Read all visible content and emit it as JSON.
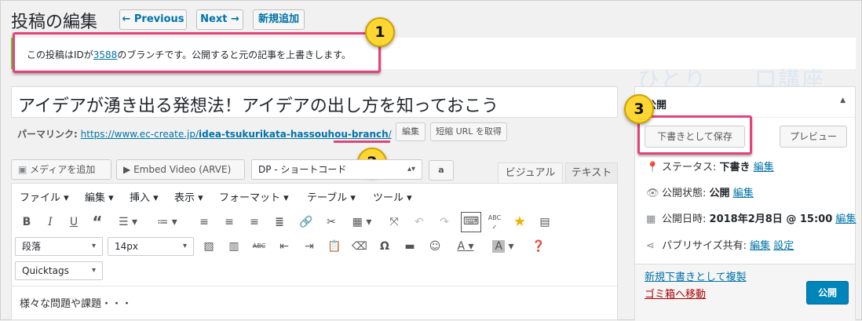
{
  "header": {
    "title": "投稿の編集",
    "prev_label": "← Previous",
    "next_label": "Next →",
    "new_label": "新規追加"
  },
  "notice": {
    "prefix": "この投稿はIDが",
    "post_id": "3588",
    "suffix": "のブランチです。公開すると元の記事を上書きします。"
  },
  "annotations": [
    "1",
    "2",
    "3"
  ],
  "colors": {
    "highlight": "#e2437a",
    "badge": "#ffd632",
    "link": "#0073aa",
    "primary": "#0085ba"
  },
  "post": {
    "title": "アイデアが湧き出る発想法！アイデアの出し方を知っておこう",
    "permalink_label": "パーマリンク:",
    "permalink_base": "https://www.ec-create.jp/",
    "permalink_slug": "idea-tsukurikata-hassouhou-branch",
    "permalink_end": "/",
    "edit_label": "編集",
    "shortlink_label": "短縮 URL を取得"
  },
  "media": {
    "add_media": "メディアを追加",
    "embed_video": "Embed Video (ARVE)",
    "shortcode_select": "DP - ショートコード",
    "amazon_button": "a"
  },
  "tabs": {
    "visual": "ビジュアル",
    "text": "テキスト"
  },
  "menubar": [
    "ファイル",
    "編集",
    "挿入",
    "表示",
    "フォーマット",
    "テーブル",
    "ツール"
  ],
  "toolbar1_icons": [
    "bold-icon",
    "italic-icon",
    "underline-icon",
    "blockquote-icon",
    "bullet-list-icon",
    "numbered-list-icon",
    "align-left-icon",
    "align-center-icon",
    "align-right-icon",
    "justify-icon",
    "link-icon",
    "unlink-icon",
    "table-icon",
    "fullscreen-icon",
    "undo-icon",
    "redo-icon",
    "keyboard-icon",
    "spellcheck-icon",
    "star-icon",
    "toggle-toolbar-icon"
  ],
  "toolbar2": {
    "format_select": "段落",
    "size_select": "14px",
    "quicktags_select": "Quicktags"
  },
  "toolbar2_icons": [
    "image-icon",
    "video-icon",
    "strikethrough-icon",
    "outdent-icon",
    "indent-icon",
    "paste-icon",
    "eraser-icon",
    "omega-icon",
    "hr-icon",
    "emoji-icon",
    "text-color-icon",
    "bg-color-icon",
    "help-icon"
  ],
  "editor_content": "様々な問題や課題・・・",
  "watermark": "ひとり　　口講座",
  "publish_box": {
    "title": "公開",
    "save_draft": "下書きとして保存",
    "preview": "プレビュー",
    "status_label": "ステータス:",
    "status_value": "下書き",
    "visibility_label": "公開状態:",
    "visibility_value": "公開",
    "schedule_label": "公開日時:",
    "schedule_value": "2018年2月8日 @ 15:00",
    "share_label": "パブリサイズ共有:",
    "edit_link": "編集",
    "settings_link": "設定",
    "copy_draft_link": "新規下書きとして複製",
    "trash_link": "ゴミ箱へ移動",
    "publish_button": "公開"
  }
}
